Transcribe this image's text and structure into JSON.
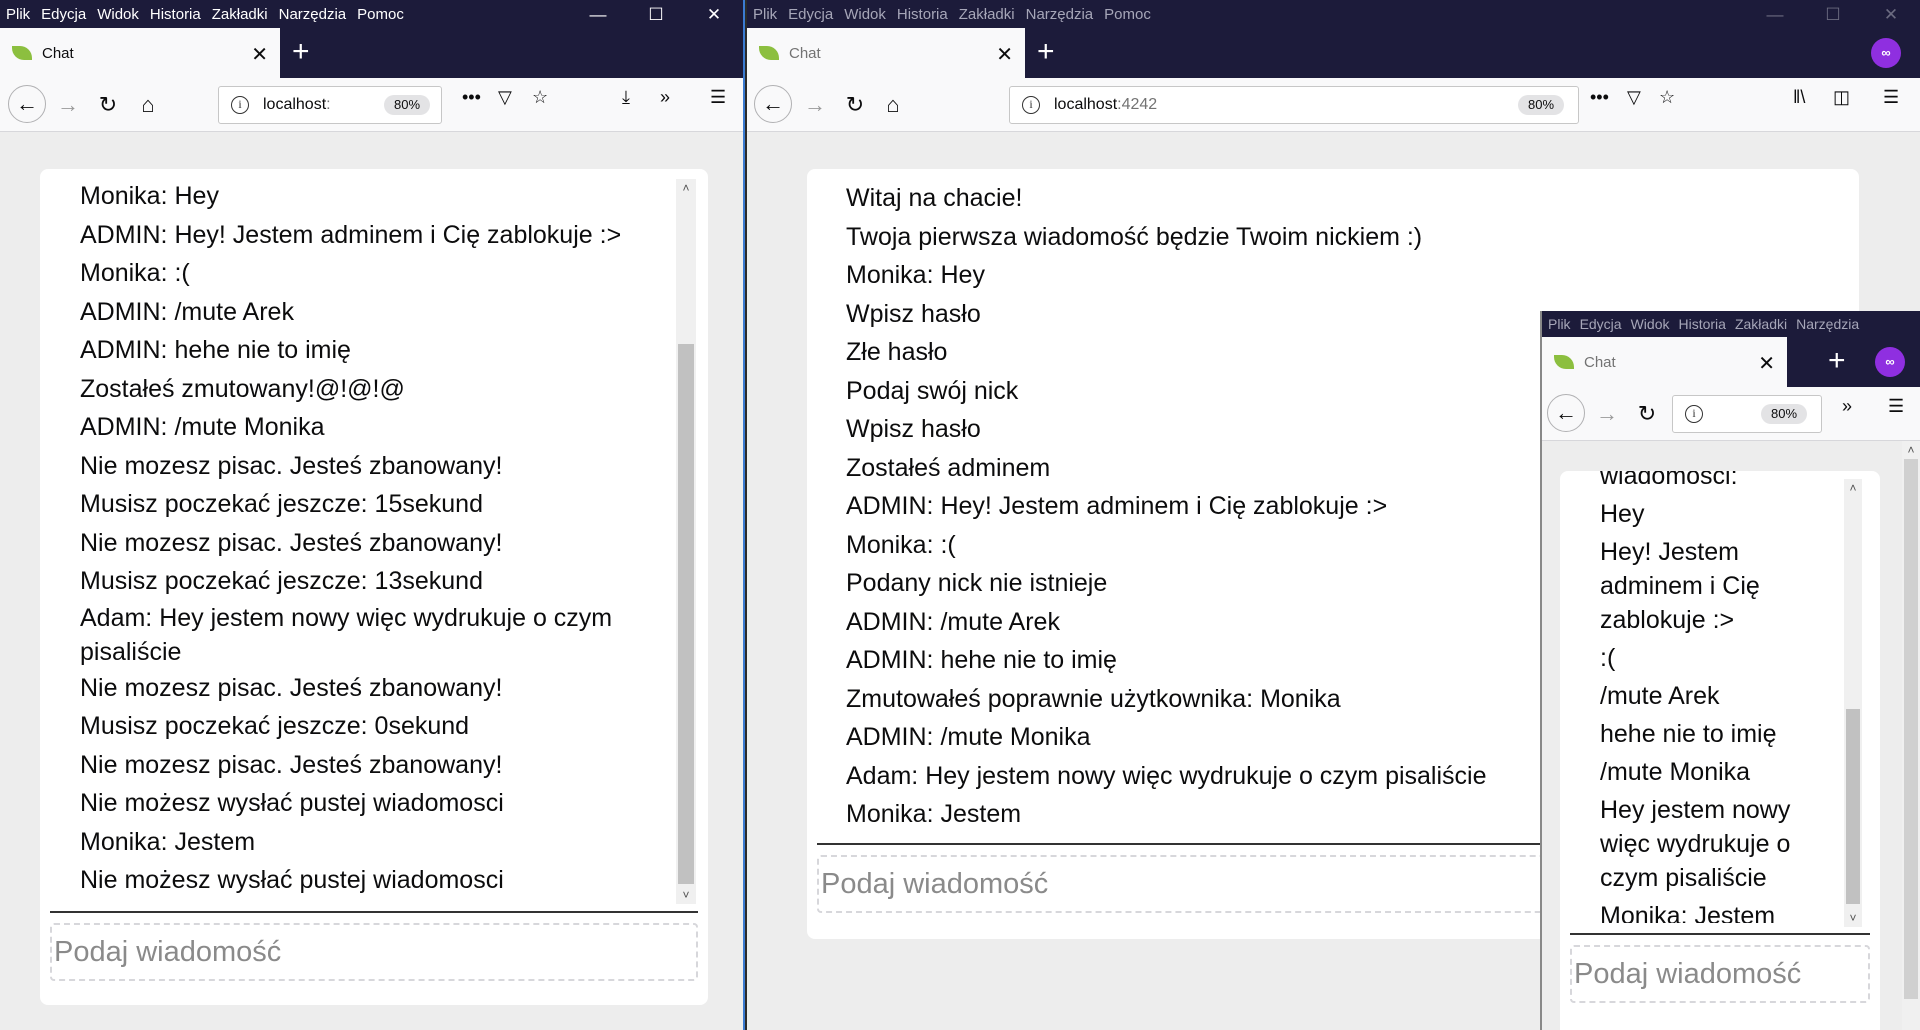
{
  "menu": [
    "Plik",
    "Edycja",
    "Widok",
    "Historia",
    "Zakładki",
    "Narzędzia",
    "Pomoc"
  ],
  "menu_underline": [
    "P",
    "E",
    "W",
    "H",
    "Z",
    "N",
    "P"
  ],
  "tab_title": "Chat",
  "left_window": {
    "url_host": "localhost",
    "url_port": ":",
    "zoom": "80%",
    "messages": [
      "Monika: Hey",
      "ADMIN: Hey! Jestem adminem i Cię zablokuje :>",
      "Monika: :(",
      "ADMIN: /mute Arek",
      "ADMIN: hehe nie to imię",
      "Zostałeś zmutowany!@!@!@",
      "ADMIN: /mute Monika",
      "Nie mozesz pisac. Jesteś zbanowany!",
      "Musisz poczekać jeszcze: 15sekund",
      "Nie mozesz pisac. Jesteś zbanowany!",
      "Musisz poczekać jeszcze: 13sekund",
      "Adam: Hey jestem nowy więc wydrukuje o czym",
      "pisaliście",
      "Nie mozesz pisac. Jesteś zbanowany!",
      "Musisz poczekać jeszcze: 0sekund",
      "Nie mozesz pisac. Jesteś zbanowany!",
      "Nie możesz wysłać pustej wiadomosci",
      "Monika: Jestem",
      "Nie możesz wysłać pustej wiadomosci"
    ],
    "input_placeholder": "Podaj wiadomość",
    "scroll_fraction": 0.55
  },
  "middle_window": {
    "url_host": "localhost",
    "url_port": ":4242",
    "zoom": "80%",
    "messages": [
      "Witaj na chacie!",
      "Twoja pierwsza wiadomość będzie Twoim nickiem :)",
      "Monika: Hey",
      "Wpisz hasło",
      "Złe hasło",
      "Podaj swój nick",
      "Wpisz hasło",
      "Zostałeś adminem",
      "ADMIN: Hey! Jestem adminem i Cię zablokuje :>",
      "Monika: :(",
      "Podany nick nie istnieje",
      "ADMIN: /mute Arek",
      "ADMIN: hehe nie to imię",
      "Zmutowałeś poprawnie użytkownika: Monika",
      "ADMIN: /mute Monika",
      "Adam: Hey jestem nowy więc wydrukuje o czym pisaliście",
      "Monika: Jestem"
    ],
    "input_placeholder": "Podaj wiadomość"
  },
  "right_window": {
    "zoom": "80%",
    "messages": [
      "wiadomości:",
      "Hey",
      "Hey! Jestem",
      "adminem i Cię",
      "zablokuje :>",
      ":(",
      "/mute Arek",
      "hehe nie to imię",
      "/mute Monika",
      "Hey jestem nowy",
      "więc wydrukuje o",
      "czym pisaliście",
      "Monika: Jestem"
    ],
    "input_placeholder": "Podaj wiadomość"
  }
}
